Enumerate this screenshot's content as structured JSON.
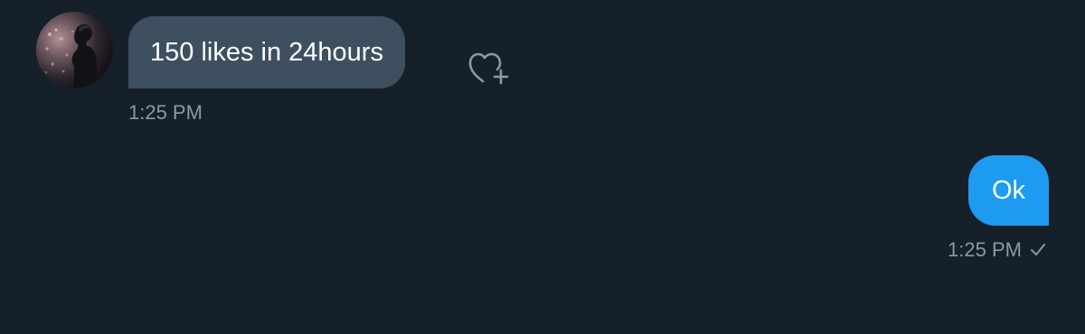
{
  "conversation": {
    "received_message": {
      "text": "150 likes in 24hours",
      "timestamp": "1:25 PM",
      "reaction_icon": "heart-plus-icon",
      "avatar_icon": "profile-avatar"
    },
    "sent_message": {
      "text": "Ok",
      "timestamp": "1:25 PM",
      "status_icon": "check-icon"
    }
  },
  "colors": {
    "background": "#16202a",
    "received_bubble": "#3e5060",
    "sent_bubble": "#1d9bf0",
    "meta_text": "#8b98a5",
    "message_text": "#ffffff"
  }
}
